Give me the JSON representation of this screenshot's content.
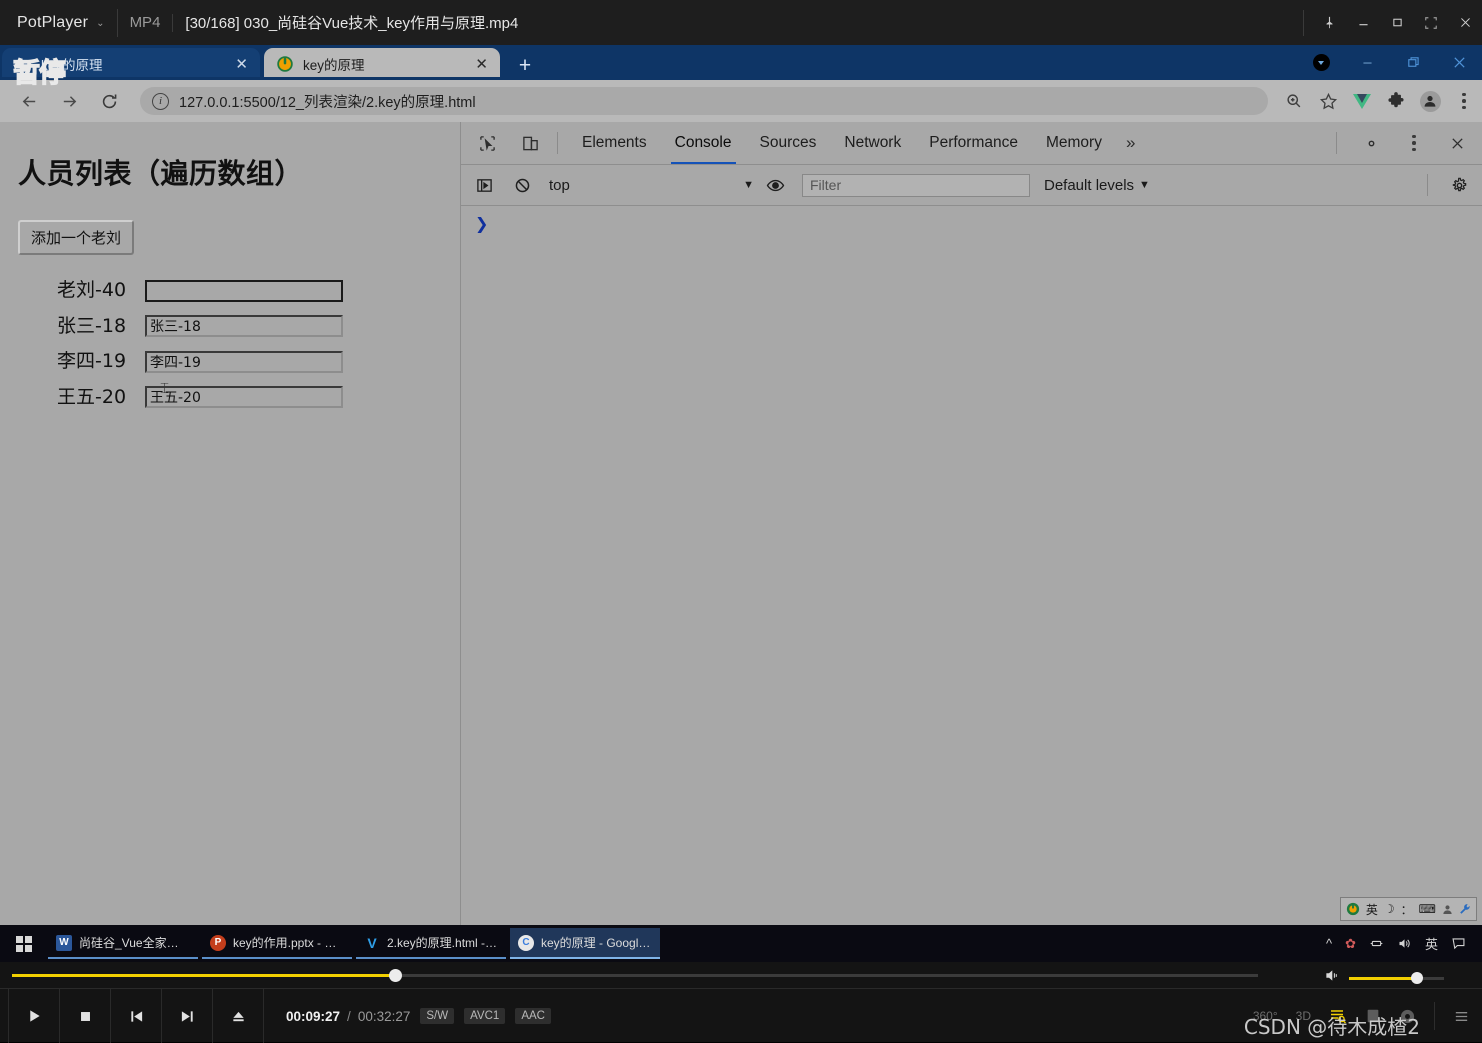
{
  "player": {
    "app_name": "PotPlayer",
    "caret": "⌄",
    "format": "MP4",
    "file_title": "[30/168] 030_尚硅谷Vue技术_key作用与原理.mp4",
    "paused_overlay": "暂停",
    "time_current": "00:09:27",
    "time_separator": "/",
    "time_total": "00:32:27",
    "chips": [
      "S/W",
      "AVC1",
      "AAC"
    ],
    "right_buttons": [
      "360°",
      "3D"
    ],
    "watermark": "CSDN @待木成楂2",
    "progress_percent": 30.7,
    "volume_percent": 72,
    "accent_color": "#f2d001"
  },
  "browser": {
    "tabs": [
      {
        "title": "key的原理",
        "close": "✕",
        "active": false
      },
      {
        "title": "key的原理",
        "close": "✕",
        "active": true
      }
    ],
    "new_tab_label": "+",
    "url": "127.0.0.1:5500/12_列表渲染/2.key的原理.html",
    "toolbar_icons": [
      "zoom-icon",
      "bookmark-star-icon",
      "vue-devtools-icon",
      "extensions-puzzle-icon",
      "profile-avatar-icon",
      "chrome-menu-icon"
    ]
  },
  "page": {
    "heading": "人员列表（遍历数组）",
    "add_button": "添加一个老刘",
    "people": [
      {
        "label": "老刘-40",
        "input_value": "",
        "focused": true
      },
      {
        "label": "张三-18",
        "input_value": "张三-18",
        "focused": false
      },
      {
        "label": "李四-19",
        "input_value": "李四-19",
        "focused": false
      },
      {
        "label": "王五-20",
        "input_value": "王五-20",
        "focused": false
      }
    ]
  },
  "devtools": {
    "tabs": [
      {
        "label": "Elements",
        "selected": false
      },
      {
        "label": "Console",
        "selected": true
      },
      {
        "label": "Sources",
        "selected": false
      },
      {
        "label": "Network",
        "selected": false
      },
      {
        "label": "Performance",
        "selected": false
      },
      {
        "label": "Memory",
        "selected": false
      }
    ],
    "more_label": "»",
    "context_selector": "top",
    "context_arrow": "▼",
    "filter_placeholder": "Filter",
    "levels_label": "Default levels",
    "levels_arrow": "▼",
    "prompt": "❯"
  },
  "ime": {
    "glyphs": [
      "英",
      "☽",
      "：",
      "⌨",
      "👤",
      "🔧"
    ]
  },
  "taskbar": {
    "items": [
      {
        "label": "尚硅谷_Vue全家桶.d...",
        "icon": "W",
        "icon_color": "#2b579a",
        "active": false
      },
      {
        "label": "key的作用.pptx - Po...",
        "icon": "P",
        "icon_color": "#c43e1c",
        "active": false
      },
      {
        "label": "2.key的原理.html - v...",
        "icon": "V",
        "icon_color": "#0c63b8",
        "active": false
      },
      {
        "label": "key的原理 - Google...",
        "icon": "C",
        "icon_color": "#e8e8e8",
        "active": true
      }
    ],
    "tray": [
      "^",
      "✿",
      "🖧",
      "🔊",
      "英",
      "🗨"
    ]
  }
}
